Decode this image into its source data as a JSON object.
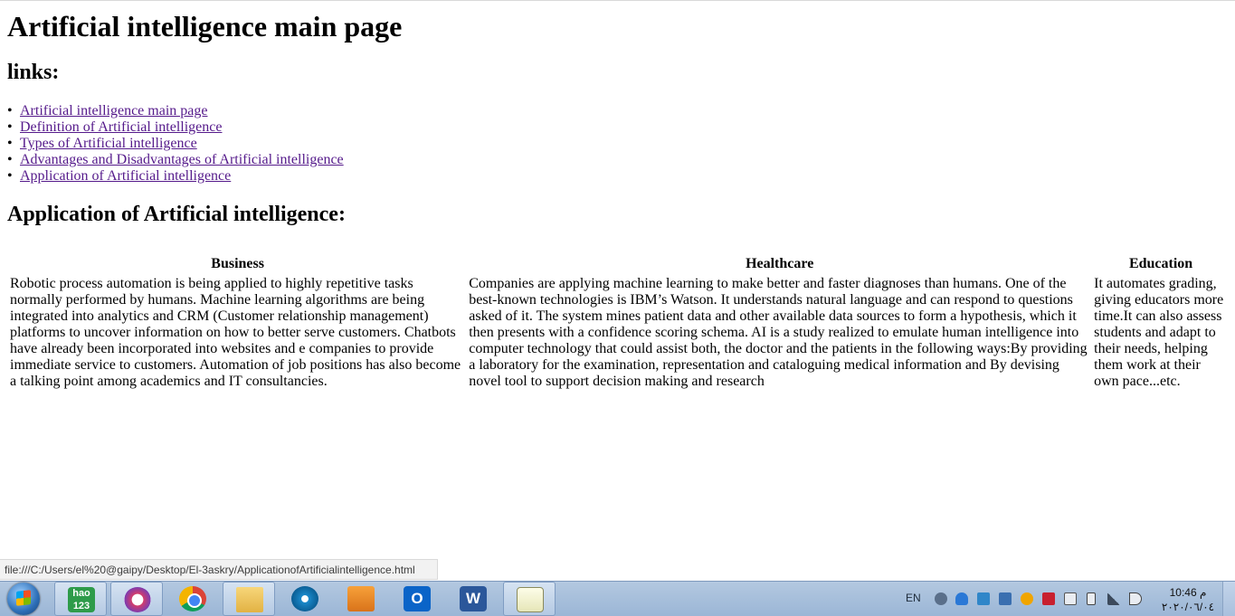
{
  "page": {
    "title": "Artificial intelligence main page",
    "links_heading": "links:",
    "links": [
      "Artificial intelligence main page",
      "Definition of Artificial intelligence",
      "Types of Artificial intelligence",
      "Advantages and Disadvantages of Artificial intelligence",
      "Application of Artificial intelligence"
    ],
    "section_heading": "Application of Artificial intelligence:",
    "table": {
      "headers": [
        "Business",
        "Healthcare",
        "Education"
      ],
      "cells": [
        "Robotic process automation is being applied to highly repetitive tasks normally performed by humans. Machine learning algorithms are being integrated into analytics and CRM (Customer relationship management) platforms to uncover information on how to better serve customers. Chatbots have already been incorporated into websites and e companies to provide immediate service to customers. Automation of job positions has also become a talking point among academics and IT consultancies.",
        "Companies are applying machine learning to make better and faster diagnoses than humans. One of the best-known technologies is IBM’s Watson. It understands natural language and can respond to questions asked of it. The system mines patient data and other available data sources to form a hypothesis, which it then presents with a confidence scoring schema. AI is a study realized to emulate human intelligence into computer technology that could assist both, the doctor and the patients in the following ways:By providing a laboratory for the examination, representation and cataloguing medical information and By devising novel tool to support decision making and research",
        "It automates grading, giving educators more time.It can also assess students and adapt to their needs, helping them work at their own pace...etc."
      ]
    }
  },
  "status_bar": {
    "url": "file:///C:/Users/el%20@gaipy/Desktop/El-3askry/ApplicationofArtificialintelligence.html"
  },
  "taskbar": {
    "pinned": [
      {
        "name": "hao123",
        "label": "hao\n123",
        "active": true
      },
      {
        "name": "sogou-browser",
        "label": "",
        "active": true
      },
      {
        "name": "chrome",
        "label": "",
        "active": false
      },
      {
        "name": "file-explorer",
        "label": "",
        "active": true
      },
      {
        "name": "media-center",
        "label": "",
        "active": false
      },
      {
        "name": "media-player",
        "label": "",
        "active": false
      },
      {
        "name": "outlook",
        "label": "O",
        "active": false
      },
      {
        "name": "word",
        "label": "W",
        "active": false
      },
      {
        "name": "notepad-plus",
        "label": "",
        "active": true
      }
    ],
    "language": "EN",
    "clock_time": "10:46 م",
    "clock_date": "٢٠٢٠/٠٦/٠٤"
  }
}
